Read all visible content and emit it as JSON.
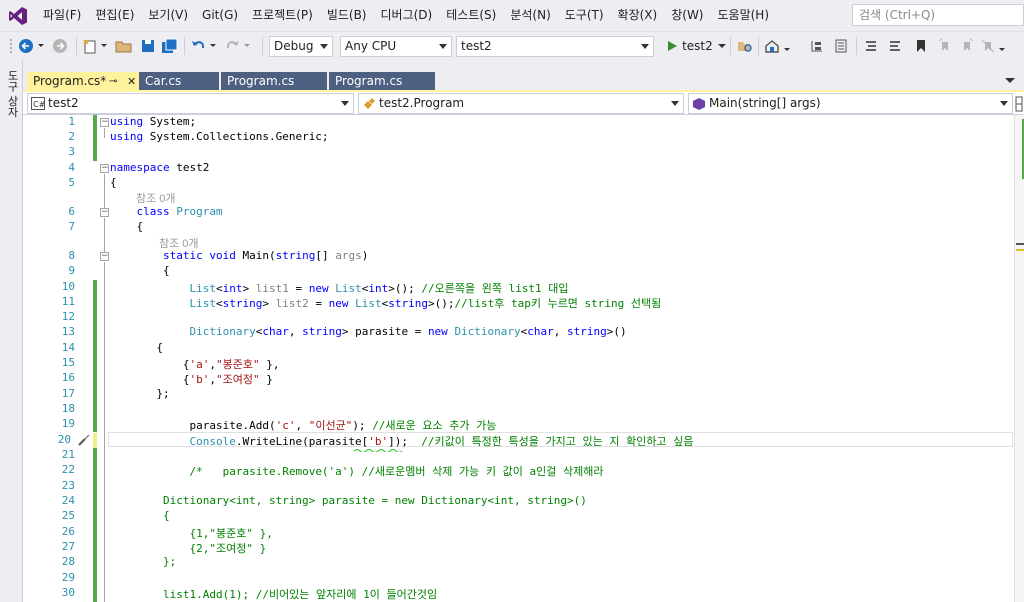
{
  "menu": {
    "items": [
      "파일(F)",
      "편집(E)",
      "보기(V)",
      "Git(G)",
      "프로젝트(P)",
      "빌드(B)",
      "디버그(D)",
      "테스트(S)",
      "분석(N)",
      "도구(T)",
      "확장(X)",
      "창(W)",
      "도움말(H)"
    ],
    "search_placeholder": "검색 (Ctrl+Q)"
  },
  "toolbar": {
    "configuration": "Debug",
    "platform": "Any CPU",
    "startup_project": "test2",
    "run_label": "test2"
  },
  "toolbox_label": "도구 상자",
  "tabs": [
    {
      "label": "Program.cs*",
      "pin": "⊸",
      "close": "✕",
      "active": true
    },
    {
      "label": "Car.cs",
      "active": false
    },
    {
      "label": "Program.cs",
      "active": false
    },
    {
      "label": "Program.cs",
      "active": false
    }
  ],
  "navbar": {
    "project": "test2",
    "type": "test2.Program",
    "member": "Main(string[] args)"
  },
  "editor": {
    "line_numbers": [
      "1",
      "2",
      "3",
      "4",
      "5",
      "6",
      "7",
      "8",
      "9",
      "10",
      "11",
      "12",
      "13",
      "14",
      "15",
      "16",
      "17",
      "18",
      "19",
      "20",
      "21",
      "22",
      "23",
      "24",
      "25",
      "26",
      "27",
      "28",
      "29",
      "30"
    ],
    "codelens": [
      "참조 0개",
      "참조 0개"
    ],
    "lines": {
      "l1": [
        "using",
        " System;"
      ],
      "l2": [
        "using",
        " System.Collections.Generic;"
      ],
      "l4": [
        "namespace",
        " test2"
      ],
      "l5": "{",
      "l6": [
        "class",
        " ",
        "Program"
      ],
      "l7": "{",
      "l8": [
        "static",
        " ",
        "void",
        " Main(",
        "string",
        "[] ",
        "args",
        ")"
      ],
      "l9": "{",
      "l10": [
        "List",
        "<",
        "int",
        "> ",
        "list1",
        " = ",
        "new",
        " ",
        "List",
        "<",
        "int",
        ">(); ",
        "//오른쪽을 왼쪽 list1 대입"
      ],
      "l11": [
        "List",
        "<",
        "string",
        "> ",
        "list2",
        " = ",
        "new",
        " ",
        "List",
        "<",
        "string",
        ">();",
        "//list후 tap키 누르면 string 선택됨"
      ],
      "l13": [
        "Dictionary",
        "<",
        "char",
        ", ",
        "string",
        "> parasite = ",
        "new",
        " ",
        "Dictionary",
        "<",
        "char",
        ", ",
        "string",
        ">()"
      ],
      "l14": "{",
      "l15": [
        "{",
        "'a'",
        ",",
        "\"봉준호\"",
        " },"
      ],
      "l16": [
        "{",
        "'b'",
        ",",
        "\"조여정\"",
        " }"
      ],
      "l17": "};",
      "l19": [
        "parasite.Add(",
        "'c'",
        ", ",
        "\"이선균\"",
        "); ",
        "//새로운 요소 추가 가능"
      ],
      "l20": [
        "Console",
        ".WriteLine(parasite[",
        "'b'",
        "]);  ",
        "//키값이 특정한 특성을 가지고 있는 지 확인하고 싶음"
      ],
      "l22": "/*   parasite.Remove('a') //새로운멤버 삭제 가능 키 값이 a인걸 삭제해라",
      "l24": "Dictionary<int, string> parasite = new Dictionary<int, string>()",
      "l25": "{",
      "l26": "{1,\"봉준호\" },",
      "l27": "{2,\"조여정\" }",
      "l28": "};",
      "l30": "list1.Add(1); //비어있는 앞자리에 1이 들어간것임"
    }
  },
  "colors": {
    "keyword": "#0000ff",
    "type": "#2b91af",
    "string": "#a31515",
    "comment": "#008000",
    "change_bar": "#57a64a",
    "active_tab": "#fff29d",
    "inactive_tab": "#4d6082"
  },
  "icons": [
    "visual-studio-logo-icon",
    "back-icon",
    "forward-icon",
    "new-project-icon",
    "open-folder-icon",
    "save-icon",
    "save-all-icon",
    "undo-icon",
    "redo-icon",
    "run-icon",
    "find-in-files-icon",
    "solution-explorer-icon",
    "bookmark-icon",
    "screwdriver-icon"
  ]
}
